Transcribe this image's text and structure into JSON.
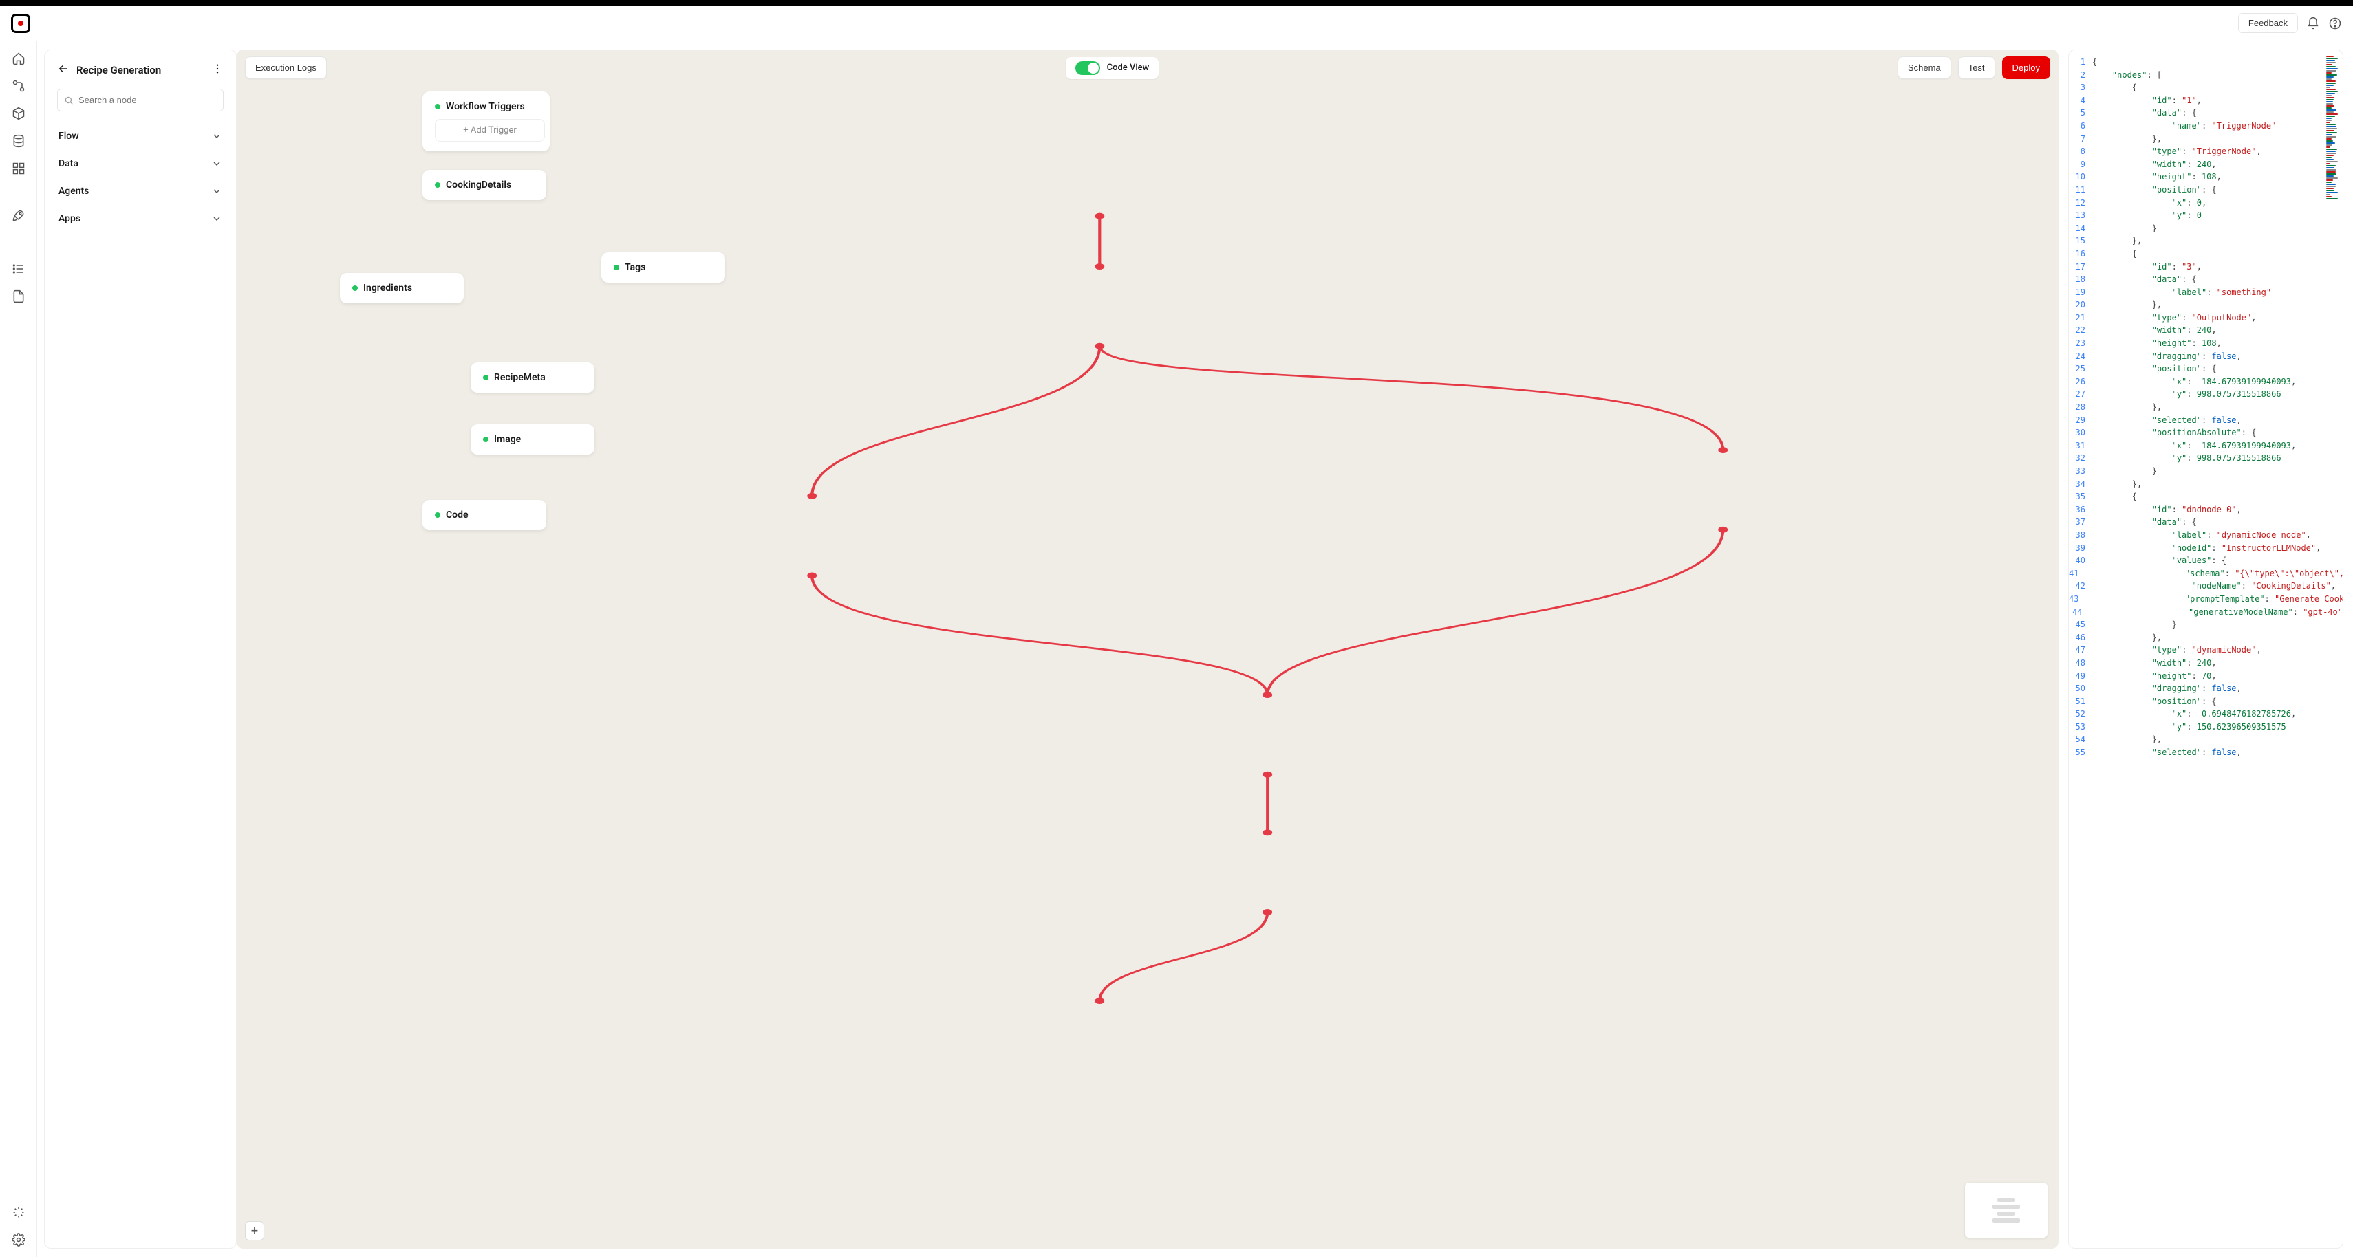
{
  "header": {
    "feedback": "Feedback"
  },
  "sidepanel": {
    "title": "Recipe Generation",
    "search_placeholder": "Search a node",
    "categories": [
      "Flow",
      "Data",
      "Agents",
      "Apps"
    ]
  },
  "toolbar": {
    "execution_logs": "Execution Logs",
    "code_view": "Code View",
    "schema": "Schema",
    "test": "Test",
    "deploy": "Deploy"
  },
  "nodes": {
    "triggers": {
      "title": "Workflow Triggers",
      "add": "+ Add Trigger"
    },
    "cooking": {
      "title": "CookingDetails"
    },
    "ingredients": {
      "title": "Ingredients"
    },
    "tags": {
      "title": "Tags"
    },
    "recipemeta": {
      "title": "RecipeMeta"
    },
    "image": {
      "title": "Image"
    },
    "code": {
      "title": "Code"
    }
  },
  "code": {
    "lines": [
      [
        [
          "p",
          "{"
        ]
      ],
      [
        [
          "p",
          "    "
        ],
        [
          "k",
          "\"nodes\""
        ],
        [
          "p",
          ": ["
        ]
      ],
      [
        [
          "p",
          "        {"
        ]
      ],
      [
        [
          "p",
          "            "
        ],
        [
          "k",
          "\"id\""
        ],
        [
          "p",
          ": "
        ],
        [
          "s",
          "\"1\""
        ],
        [
          "p",
          ","
        ]
      ],
      [
        [
          "p",
          "            "
        ],
        [
          "k",
          "\"data\""
        ],
        [
          "p",
          ": {"
        ]
      ],
      [
        [
          "p",
          "                "
        ],
        [
          "k",
          "\"name\""
        ],
        [
          "p",
          ": "
        ],
        [
          "s",
          "\"TriggerNode\""
        ]
      ],
      [
        [
          "p",
          "            },"
        ]
      ],
      [
        [
          "p",
          "            "
        ],
        [
          "k",
          "\"type\""
        ],
        [
          "p",
          ": "
        ],
        [
          "s",
          "\"TriggerNode\""
        ],
        [
          "p",
          ","
        ]
      ],
      [
        [
          "p",
          "            "
        ],
        [
          "k",
          "\"width\""
        ],
        [
          "p",
          ": "
        ],
        [
          "n",
          "240"
        ],
        [
          "p",
          ","
        ]
      ],
      [
        [
          "p",
          "            "
        ],
        [
          "k",
          "\"height\""
        ],
        [
          "p",
          ": "
        ],
        [
          "n",
          "108"
        ],
        [
          "p",
          ","
        ]
      ],
      [
        [
          "p",
          "            "
        ],
        [
          "k",
          "\"position\""
        ],
        [
          "p",
          ": {"
        ]
      ],
      [
        [
          "p",
          "                "
        ],
        [
          "k",
          "\"x\""
        ],
        [
          "p",
          ": "
        ],
        [
          "n",
          "0"
        ],
        [
          "p",
          ","
        ]
      ],
      [
        [
          "p",
          "                "
        ],
        [
          "k",
          "\"y\""
        ],
        [
          "p",
          ": "
        ],
        [
          "n",
          "0"
        ]
      ],
      [
        [
          "p",
          "            }"
        ]
      ],
      [
        [
          "p",
          "        },"
        ]
      ],
      [
        [
          "p",
          "        {"
        ]
      ],
      [
        [
          "p",
          "            "
        ],
        [
          "k",
          "\"id\""
        ],
        [
          "p",
          ": "
        ],
        [
          "s",
          "\"3\""
        ],
        [
          "p",
          ","
        ]
      ],
      [
        [
          "p",
          "            "
        ],
        [
          "k",
          "\"data\""
        ],
        [
          "p",
          ": {"
        ]
      ],
      [
        [
          "p",
          "                "
        ],
        [
          "k",
          "\"label\""
        ],
        [
          "p",
          ": "
        ],
        [
          "s",
          "\"something\""
        ]
      ],
      [
        [
          "p",
          "            },"
        ]
      ],
      [
        [
          "p",
          "            "
        ],
        [
          "k",
          "\"type\""
        ],
        [
          "p",
          ": "
        ],
        [
          "s",
          "\"OutputNode\""
        ],
        [
          "p",
          ","
        ]
      ],
      [
        [
          "p",
          "            "
        ],
        [
          "k",
          "\"width\""
        ],
        [
          "p",
          ": "
        ],
        [
          "n",
          "240"
        ],
        [
          "p",
          ","
        ]
      ],
      [
        [
          "p",
          "            "
        ],
        [
          "k",
          "\"height\""
        ],
        [
          "p",
          ": "
        ],
        [
          "n",
          "108"
        ],
        [
          "p",
          ","
        ]
      ],
      [
        [
          "p",
          "            "
        ],
        [
          "k",
          "\"dragging\""
        ],
        [
          "p",
          ": "
        ],
        [
          "b",
          "false"
        ],
        [
          "p",
          ","
        ]
      ],
      [
        [
          "p",
          "            "
        ],
        [
          "k",
          "\"position\""
        ],
        [
          "p",
          ": {"
        ]
      ],
      [
        [
          "p",
          "                "
        ],
        [
          "k",
          "\"x\""
        ],
        [
          "p",
          ": "
        ],
        [
          "n",
          "-184.67939199940093"
        ],
        [
          "p",
          ","
        ]
      ],
      [
        [
          "p",
          "                "
        ],
        [
          "k",
          "\"y\""
        ],
        [
          "p",
          ": "
        ],
        [
          "n",
          "998.0757315518866"
        ]
      ],
      [
        [
          "p",
          "            },"
        ]
      ],
      [
        [
          "p",
          "            "
        ],
        [
          "k",
          "\"selected\""
        ],
        [
          "p",
          ": "
        ],
        [
          "b",
          "false"
        ],
        [
          "p",
          ","
        ]
      ],
      [
        [
          "p",
          "            "
        ],
        [
          "k",
          "\"positionAbsolute\""
        ],
        [
          "p",
          ": {"
        ]
      ],
      [
        [
          "p",
          "                "
        ],
        [
          "k",
          "\"x\""
        ],
        [
          "p",
          ": "
        ],
        [
          "n",
          "-184.67939199940093"
        ],
        [
          "p",
          ","
        ]
      ],
      [
        [
          "p",
          "                "
        ],
        [
          "k",
          "\"y\""
        ],
        [
          "p",
          ": "
        ],
        [
          "n",
          "998.0757315518866"
        ]
      ],
      [
        [
          "p",
          "            }"
        ]
      ],
      [
        [
          "p",
          "        },"
        ]
      ],
      [
        [
          "p",
          "        {"
        ]
      ],
      [
        [
          "p",
          "            "
        ],
        [
          "k",
          "\"id\""
        ],
        [
          "p",
          ": "
        ],
        [
          "s",
          "\"dndnode_0\""
        ],
        [
          "p",
          ","
        ]
      ],
      [
        [
          "p",
          "            "
        ],
        [
          "k",
          "\"data\""
        ],
        [
          "p",
          ": {"
        ]
      ],
      [
        [
          "p",
          "                "
        ],
        [
          "k",
          "\"label\""
        ],
        [
          "p",
          ": "
        ],
        [
          "s",
          "\"dynamicNode node\""
        ],
        [
          "p",
          ","
        ]
      ],
      [
        [
          "p",
          "                "
        ],
        [
          "k",
          "\"nodeId\""
        ],
        [
          "p",
          ": "
        ],
        [
          "s",
          "\"InstructorLLMNode\""
        ],
        [
          "p",
          ","
        ]
      ],
      [
        [
          "p",
          "                "
        ],
        [
          "k",
          "\"values\""
        ],
        [
          "p",
          ": {"
        ]
      ],
      [
        [
          "p",
          "                    "
        ],
        [
          "k",
          "\"schema\""
        ],
        [
          "p",
          ": "
        ],
        [
          "s",
          "\"{\\\"type\\\":\\\"object\\\","
        ]
      ],
      [
        [
          "p",
          "                    "
        ],
        [
          "k",
          "\"nodeName\""
        ],
        [
          "p",
          ": "
        ],
        [
          "s",
          "\"CookingDetails\""
        ],
        [
          "p",
          ","
        ]
      ],
      [
        [
          "p",
          "                    "
        ],
        [
          "k",
          "\"promptTemplate\""
        ],
        [
          "p",
          ": "
        ],
        [
          "s",
          "\"Generate Cook"
        ]
      ],
      [
        [
          "p",
          "                    "
        ],
        [
          "k",
          "\"generativeModelName\""
        ],
        [
          "p",
          ": "
        ],
        [
          "s",
          "\"gpt-4o\""
        ]
      ],
      [
        [
          "p",
          "                }"
        ]
      ],
      [
        [
          "p",
          "            },"
        ]
      ],
      [
        [
          "p",
          "            "
        ],
        [
          "k",
          "\"type\""
        ],
        [
          "p",
          ": "
        ],
        [
          "s",
          "\"dynamicNode\""
        ],
        [
          "p",
          ","
        ]
      ],
      [
        [
          "p",
          "            "
        ],
        [
          "k",
          "\"width\""
        ],
        [
          "p",
          ": "
        ],
        [
          "n",
          "240"
        ],
        [
          "p",
          ","
        ]
      ],
      [
        [
          "p",
          "            "
        ],
        [
          "k",
          "\"height\""
        ],
        [
          "p",
          ": "
        ],
        [
          "n",
          "70"
        ],
        [
          "p",
          ","
        ]
      ],
      [
        [
          "p",
          "            "
        ],
        [
          "k",
          "\"dragging\""
        ],
        [
          "p",
          ": "
        ],
        [
          "b",
          "false"
        ],
        [
          "p",
          ","
        ]
      ],
      [
        [
          "p",
          "            "
        ],
        [
          "k",
          "\"position\""
        ],
        [
          "p",
          ": {"
        ]
      ],
      [
        [
          "p",
          "                "
        ],
        [
          "k",
          "\"x\""
        ],
        [
          "p",
          ": "
        ],
        [
          "n",
          "-0.6948476182785726"
        ],
        [
          "p",
          ","
        ]
      ],
      [
        [
          "p",
          "                "
        ],
        [
          "k",
          "\"y\""
        ],
        [
          "p",
          ": "
        ],
        [
          "n",
          "150.62396509351575"
        ]
      ],
      [
        [
          "p",
          "            },"
        ]
      ],
      [
        [
          "p",
          "            "
        ],
        [
          "k",
          "\"selected\""
        ],
        [
          "p",
          ": "
        ],
        [
          "b",
          "false"
        ],
        [
          "p",
          ","
        ]
      ]
    ]
  }
}
